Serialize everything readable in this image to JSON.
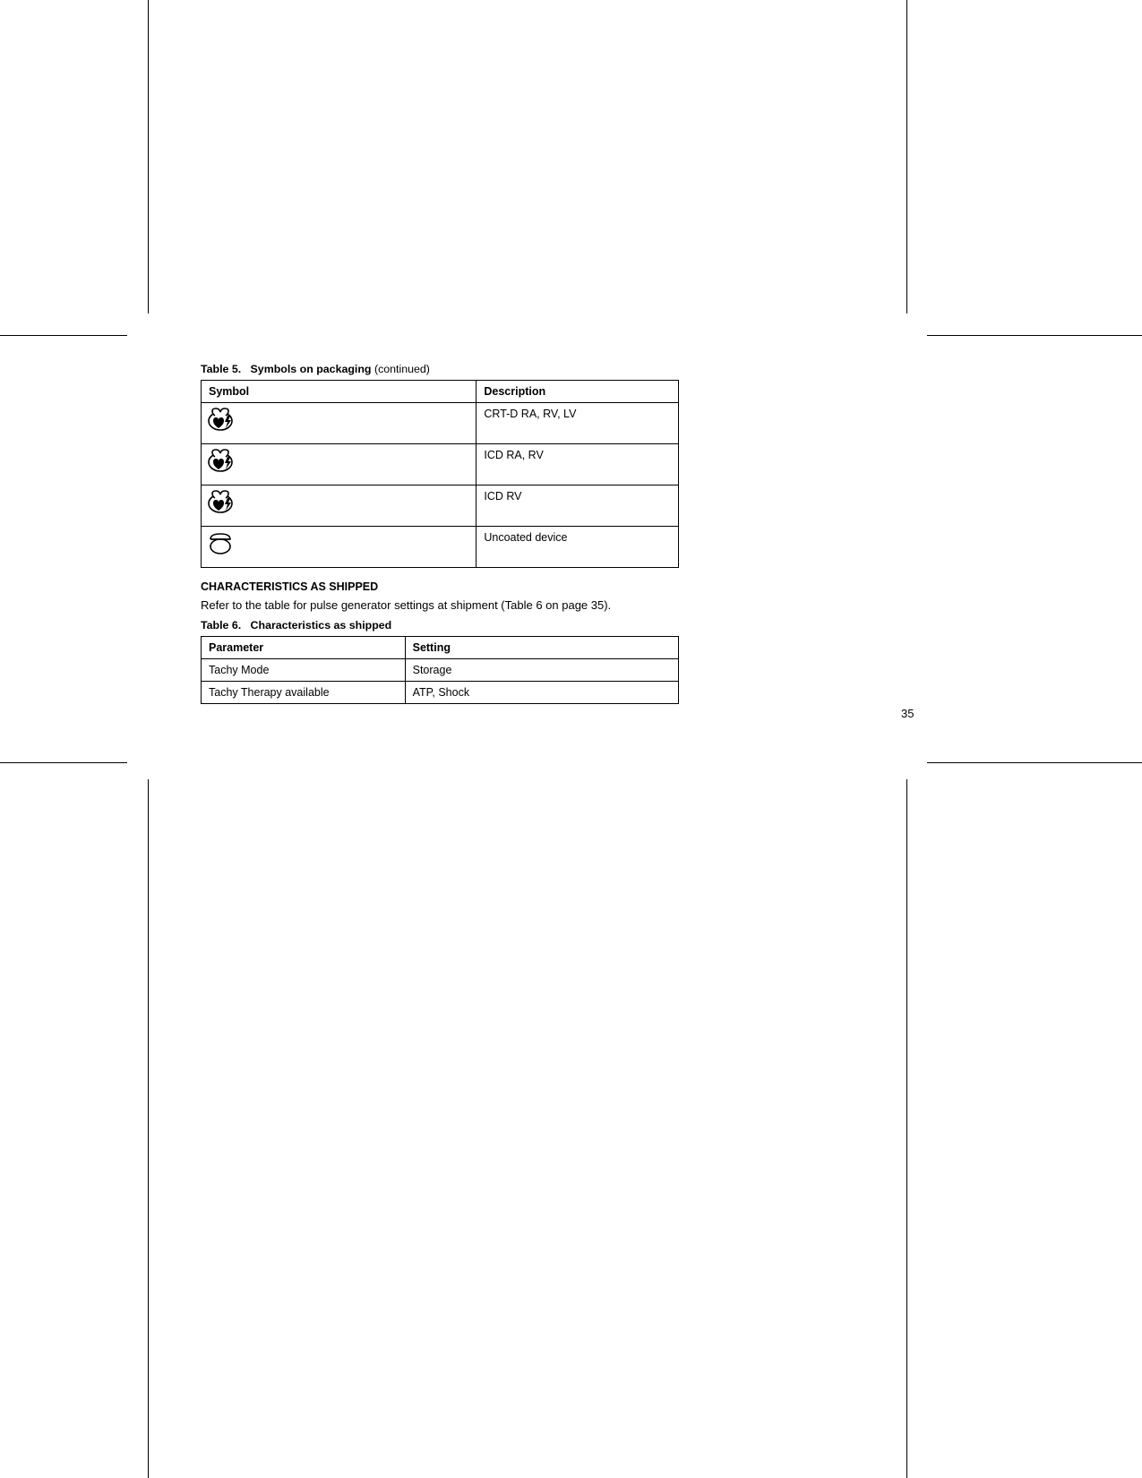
{
  "table5": {
    "caption_prefix": "Table 5.",
    "caption_title": "Symbols on packaging",
    "caption_suffix": " (continued)",
    "headers": {
      "symbol": "Symbol",
      "description": "Description"
    },
    "rows": [
      {
        "icon": "heart-bolt",
        "description": "CRT-D RA, RV, LV"
      },
      {
        "icon": "heart-bolt",
        "description": "ICD RA, RV"
      },
      {
        "icon": "heart-bolt",
        "description": "ICD RV"
      },
      {
        "icon": "capsule",
        "description": "Uncoated device"
      }
    ]
  },
  "section_heading": "CHARACTERISTICS AS SHIPPED",
  "section_body": "Refer to the table for pulse generator settings at shipment (Table 6 on page 35).",
  "table6": {
    "caption_prefix": "Table 6.",
    "caption_title": "Characteristics as shipped",
    "headers": {
      "parameter": "Parameter",
      "setting": "Setting"
    },
    "rows": [
      {
        "parameter": "Tachy Mode",
        "setting": "Storage"
      },
      {
        "parameter": "Tachy Therapy available",
        "setting": "ATP, Shock"
      }
    ]
  },
  "page_number": "35"
}
